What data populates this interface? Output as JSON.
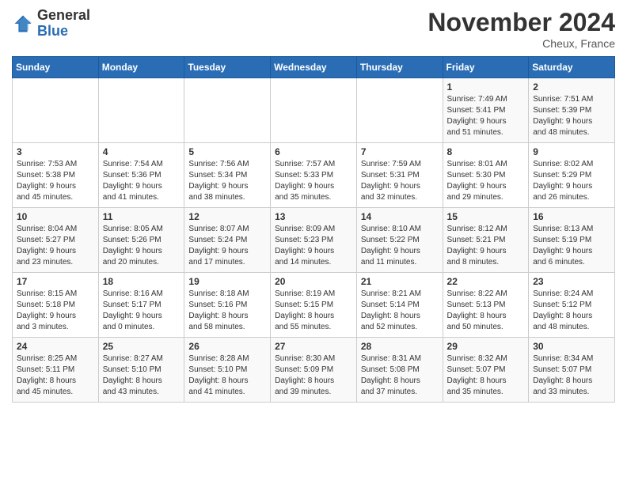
{
  "header": {
    "logo_line1": "General",
    "logo_line2": "Blue",
    "month": "November 2024",
    "location": "Cheux, France"
  },
  "days_of_week": [
    "Sunday",
    "Monday",
    "Tuesday",
    "Wednesday",
    "Thursday",
    "Friday",
    "Saturday"
  ],
  "weeks": [
    [
      {
        "day": "",
        "info": ""
      },
      {
        "day": "",
        "info": ""
      },
      {
        "day": "",
        "info": ""
      },
      {
        "day": "",
        "info": ""
      },
      {
        "day": "",
        "info": ""
      },
      {
        "day": "1",
        "info": "Sunrise: 7:49 AM\nSunset: 5:41 PM\nDaylight: 9 hours\nand 51 minutes."
      },
      {
        "day": "2",
        "info": "Sunrise: 7:51 AM\nSunset: 5:39 PM\nDaylight: 9 hours\nand 48 minutes."
      }
    ],
    [
      {
        "day": "3",
        "info": "Sunrise: 7:53 AM\nSunset: 5:38 PM\nDaylight: 9 hours\nand 45 minutes."
      },
      {
        "day": "4",
        "info": "Sunrise: 7:54 AM\nSunset: 5:36 PM\nDaylight: 9 hours\nand 41 minutes."
      },
      {
        "day": "5",
        "info": "Sunrise: 7:56 AM\nSunset: 5:34 PM\nDaylight: 9 hours\nand 38 minutes."
      },
      {
        "day": "6",
        "info": "Sunrise: 7:57 AM\nSunset: 5:33 PM\nDaylight: 9 hours\nand 35 minutes."
      },
      {
        "day": "7",
        "info": "Sunrise: 7:59 AM\nSunset: 5:31 PM\nDaylight: 9 hours\nand 32 minutes."
      },
      {
        "day": "8",
        "info": "Sunrise: 8:01 AM\nSunset: 5:30 PM\nDaylight: 9 hours\nand 29 minutes."
      },
      {
        "day": "9",
        "info": "Sunrise: 8:02 AM\nSunset: 5:29 PM\nDaylight: 9 hours\nand 26 minutes."
      }
    ],
    [
      {
        "day": "10",
        "info": "Sunrise: 8:04 AM\nSunset: 5:27 PM\nDaylight: 9 hours\nand 23 minutes."
      },
      {
        "day": "11",
        "info": "Sunrise: 8:05 AM\nSunset: 5:26 PM\nDaylight: 9 hours\nand 20 minutes."
      },
      {
        "day": "12",
        "info": "Sunrise: 8:07 AM\nSunset: 5:24 PM\nDaylight: 9 hours\nand 17 minutes."
      },
      {
        "day": "13",
        "info": "Sunrise: 8:09 AM\nSunset: 5:23 PM\nDaylight: 9 hours\nand 14 minutes."
      },
      {
        "day": "14",
        "info": "Sunrise: 8:10 AM\nSunset: 5:22 PM\nDaylight: 9 hours\nand 11 minutes."
      },
      {
        "day": "15",
        "info": "Sunrise: 8:12 AM\nSunset: 5:21 PM\nDaylight: 9 hours\nand 8 minutes."
      },
      {
        "day": "16",
        "info": "Sunrise: 8:13 AM\nSunset: 5:19 PM\nDaylight: 9 hours\nand 6 minutes."
      }
    ],
    [
      {
        "day": "17",
        "info": "Sunrise: 8:15 AM\nSunset: 5:18 PM\nDaylight: 9 hours\nand 3 minutes."
      },
      {
        "day": "18",
        "info": "Sunrise: 8:16 AM\nSunset: 5:17 PM\nDaylight: 9 hours\nand 0 minutes."
      },
      {
        "day": "19",
        "info": "Sunrise: 8:18 AM\nSunset: 5:16 PM\nDaylight: 8 hours\nand 58 minutes."
      },
      {
        "day": "20",
        "info": "Sunrise: 8:19 AM\nSunset: 5:15 PM\nDaylight: 8 hours\nand 55 minutes."
      },
      {
        "day": "21",
        "info": "Sunrise: 8:21 AM\nSunset: 5:14 PM\nDaylight: 8 hours\nand 52 minutes."
      },
      {
        "day": "22",
        "info": "Sunrise: 8:22 AM\nSunset: 5:13 PM\nDaylight: 8 hours\nand 50 minutes."
      },
      {
        "day": "23",
        "info": "Sunrise: 8:24 AM\nSunset: 5:12 PM\nDaylight: 8 hours\nand 48 minutes."
      }
    ],
    [
      {
        "day": "24",
        "info": "Sunrise: 8:25 AM\nSunset: 5:11 PM\nDaylight: 8 hours\nand 45 minutes."
      },
      {
        "day": "25",
        "info": "Sunrise: 8:27 AM\nSunset: 5:10 PM\nDaylight: 8 hours\nand 43 minutes."
      },
      {
        "day": "26",
        "info": "Sunrise: 8:28 AM\nSunset: 5:10 PM\nDaylight: 8 hours\nand 41 minutes."
      },
      {
        "day": "27",
        "info": "Sunrise: 8:30 AM\nSunset: 5:09 PM\nDaylight: 8 hours\nand 39 minutes."
      },
      {
        "day": "28",
        "info": "Sunrise: 8:31 AM\nSunset: 5:08 PM\nDaylight: 8 hours\nand 37 minutes."
      },
      {
        "day": "29",
        "info": "Sunrise: 8:32 AM\nSunset: 5:07 PM\nDaylight: 8 hours\nand 35 minutes."
      },
      {
        "day": "30",
        "info": "Sunrise: 8:34 AM\nSunset: 5:07 PM\nDaylight: 8 hours\nand 33 minutes."
      }
    ]
  ]
}
